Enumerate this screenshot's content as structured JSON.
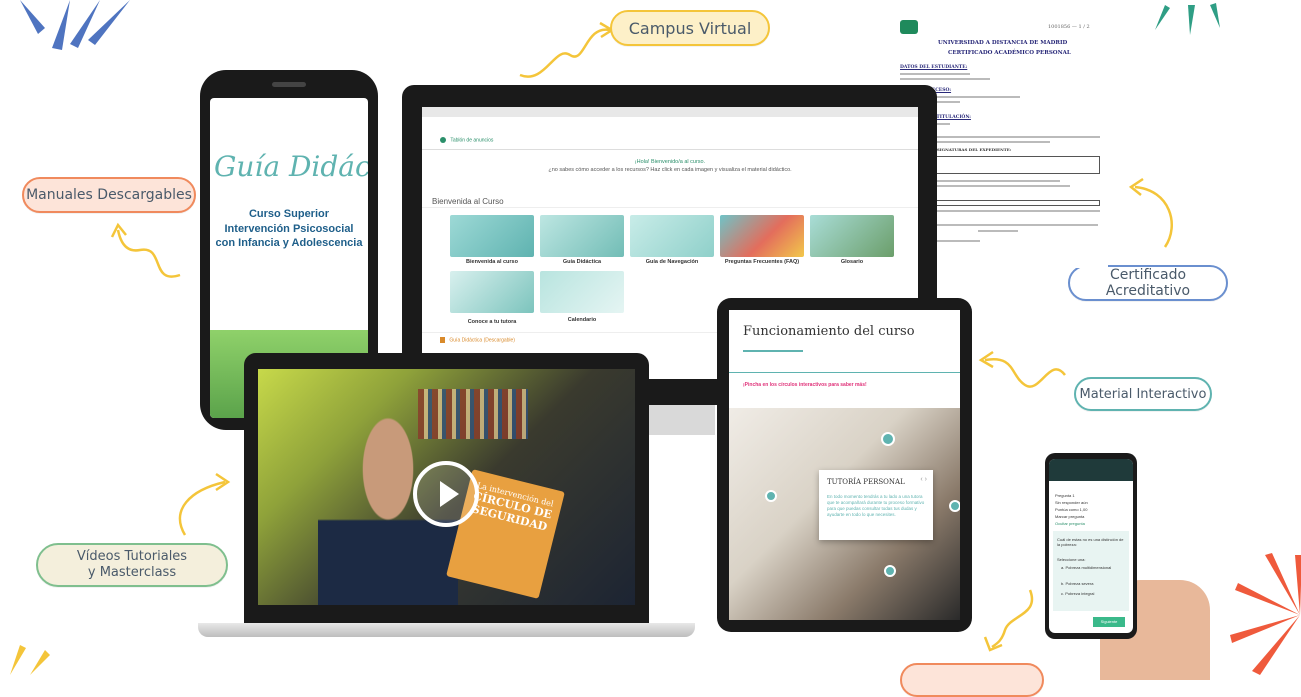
{
  "labels": {
    "campus_virtual": "Campus Virtual",
    "manuales": "Manuales Descargables",
    "certificado": "Certificado Acreditativo",
    "material": "Material Interactivo",
    "videos": "Vídeos Tutoriales\ny Masterclass"
  },
  "colors": {
    "yellow": "#f4c53a",
    "orange": "#f08a5d",
    "teal": "#5fb3b0",
    "green": "#7fbf8e",
    "blue": "#6a8fcf"
  },
  "phone": {
    "title": "Guía Didáctica",
    "subtitle": "Curso Superior",
    "course": "Intervención Psicosocial con Infancia y Adolescencia"
  },
  "monitor": {
    "breadcrumb": "Tablón de anuncios",
    "welcome_1": "¡Hola! Bienvenido/a al curso.",
    "welcome_2": "¿no sabes cómo acceder a los recursos? Haz click en cada imagen y visualiza el material didáctico.",
    "section": "Bienvenida al Curso",
    "tiles": [
      "Bienvenida al curso",
      "Guía Didáctica",
      "Guía de Navegación",
      "Preguntas Frecuentes (FAQ)",
      "Glosario",
      "Conoce a tu tutora",
      "Calendario"
    ],
    "footer_link": "Guía Didáctica (Descargable)"
  },
  "certificate": {
    "code": "1001856 — 1 / 2",
    "title_1": "UNIVERSIDAD A DISTANCIA DE MADRID",
    "title_2": "CERTIFICADO ACADÉMICO PERSONAL",
    "h1": "DATOS DEL ESTUDIANTE:",
    "h2": "DATOS DE ACCESO:",
    "h3": "DATOS DE LA TITULACIÓN:",
    "h4": "RELACIÓN DE ASIGNATURAS DEL EXPEDIENTE:"
  },
  "tablet": {
    "heading": "Funcionamiento del curso",
    "prompt": "¡Pincha en los círculos interactivos para saber más!",
    "card_title": "TUTORÍA PERSONAL",
    "card_text": "En todo momento tendrás a tu lado a una tutora que te acompañará durante tu proceso formativo para que puedas consultar todas tus dudas y ayudarte en todo lo que necesites."
  },
  "mini_phone": {
    "q1": "Pregunta 1",
    "q2": "Sin responder aún",
    "q3": "Puntúa como 1,00",
    "q4": "Marcar pregunta",
    "q5": "Ocultar pregunta",
    "question": "Cuál de estas no es una distinción de la pobreza:",
    "select": "Seleccione una:",
    "options": [
      "a. Pobreza multidimensional",
      "b. Pobreza severa",
      "c. Pobreza integral"
    ],
    "button": "Siguiente"
  },
  "laptop": {
    "book_1": "La intervención del",
    "book_2": "CÍRCULO DE SEGURIDAD"
  }
}
